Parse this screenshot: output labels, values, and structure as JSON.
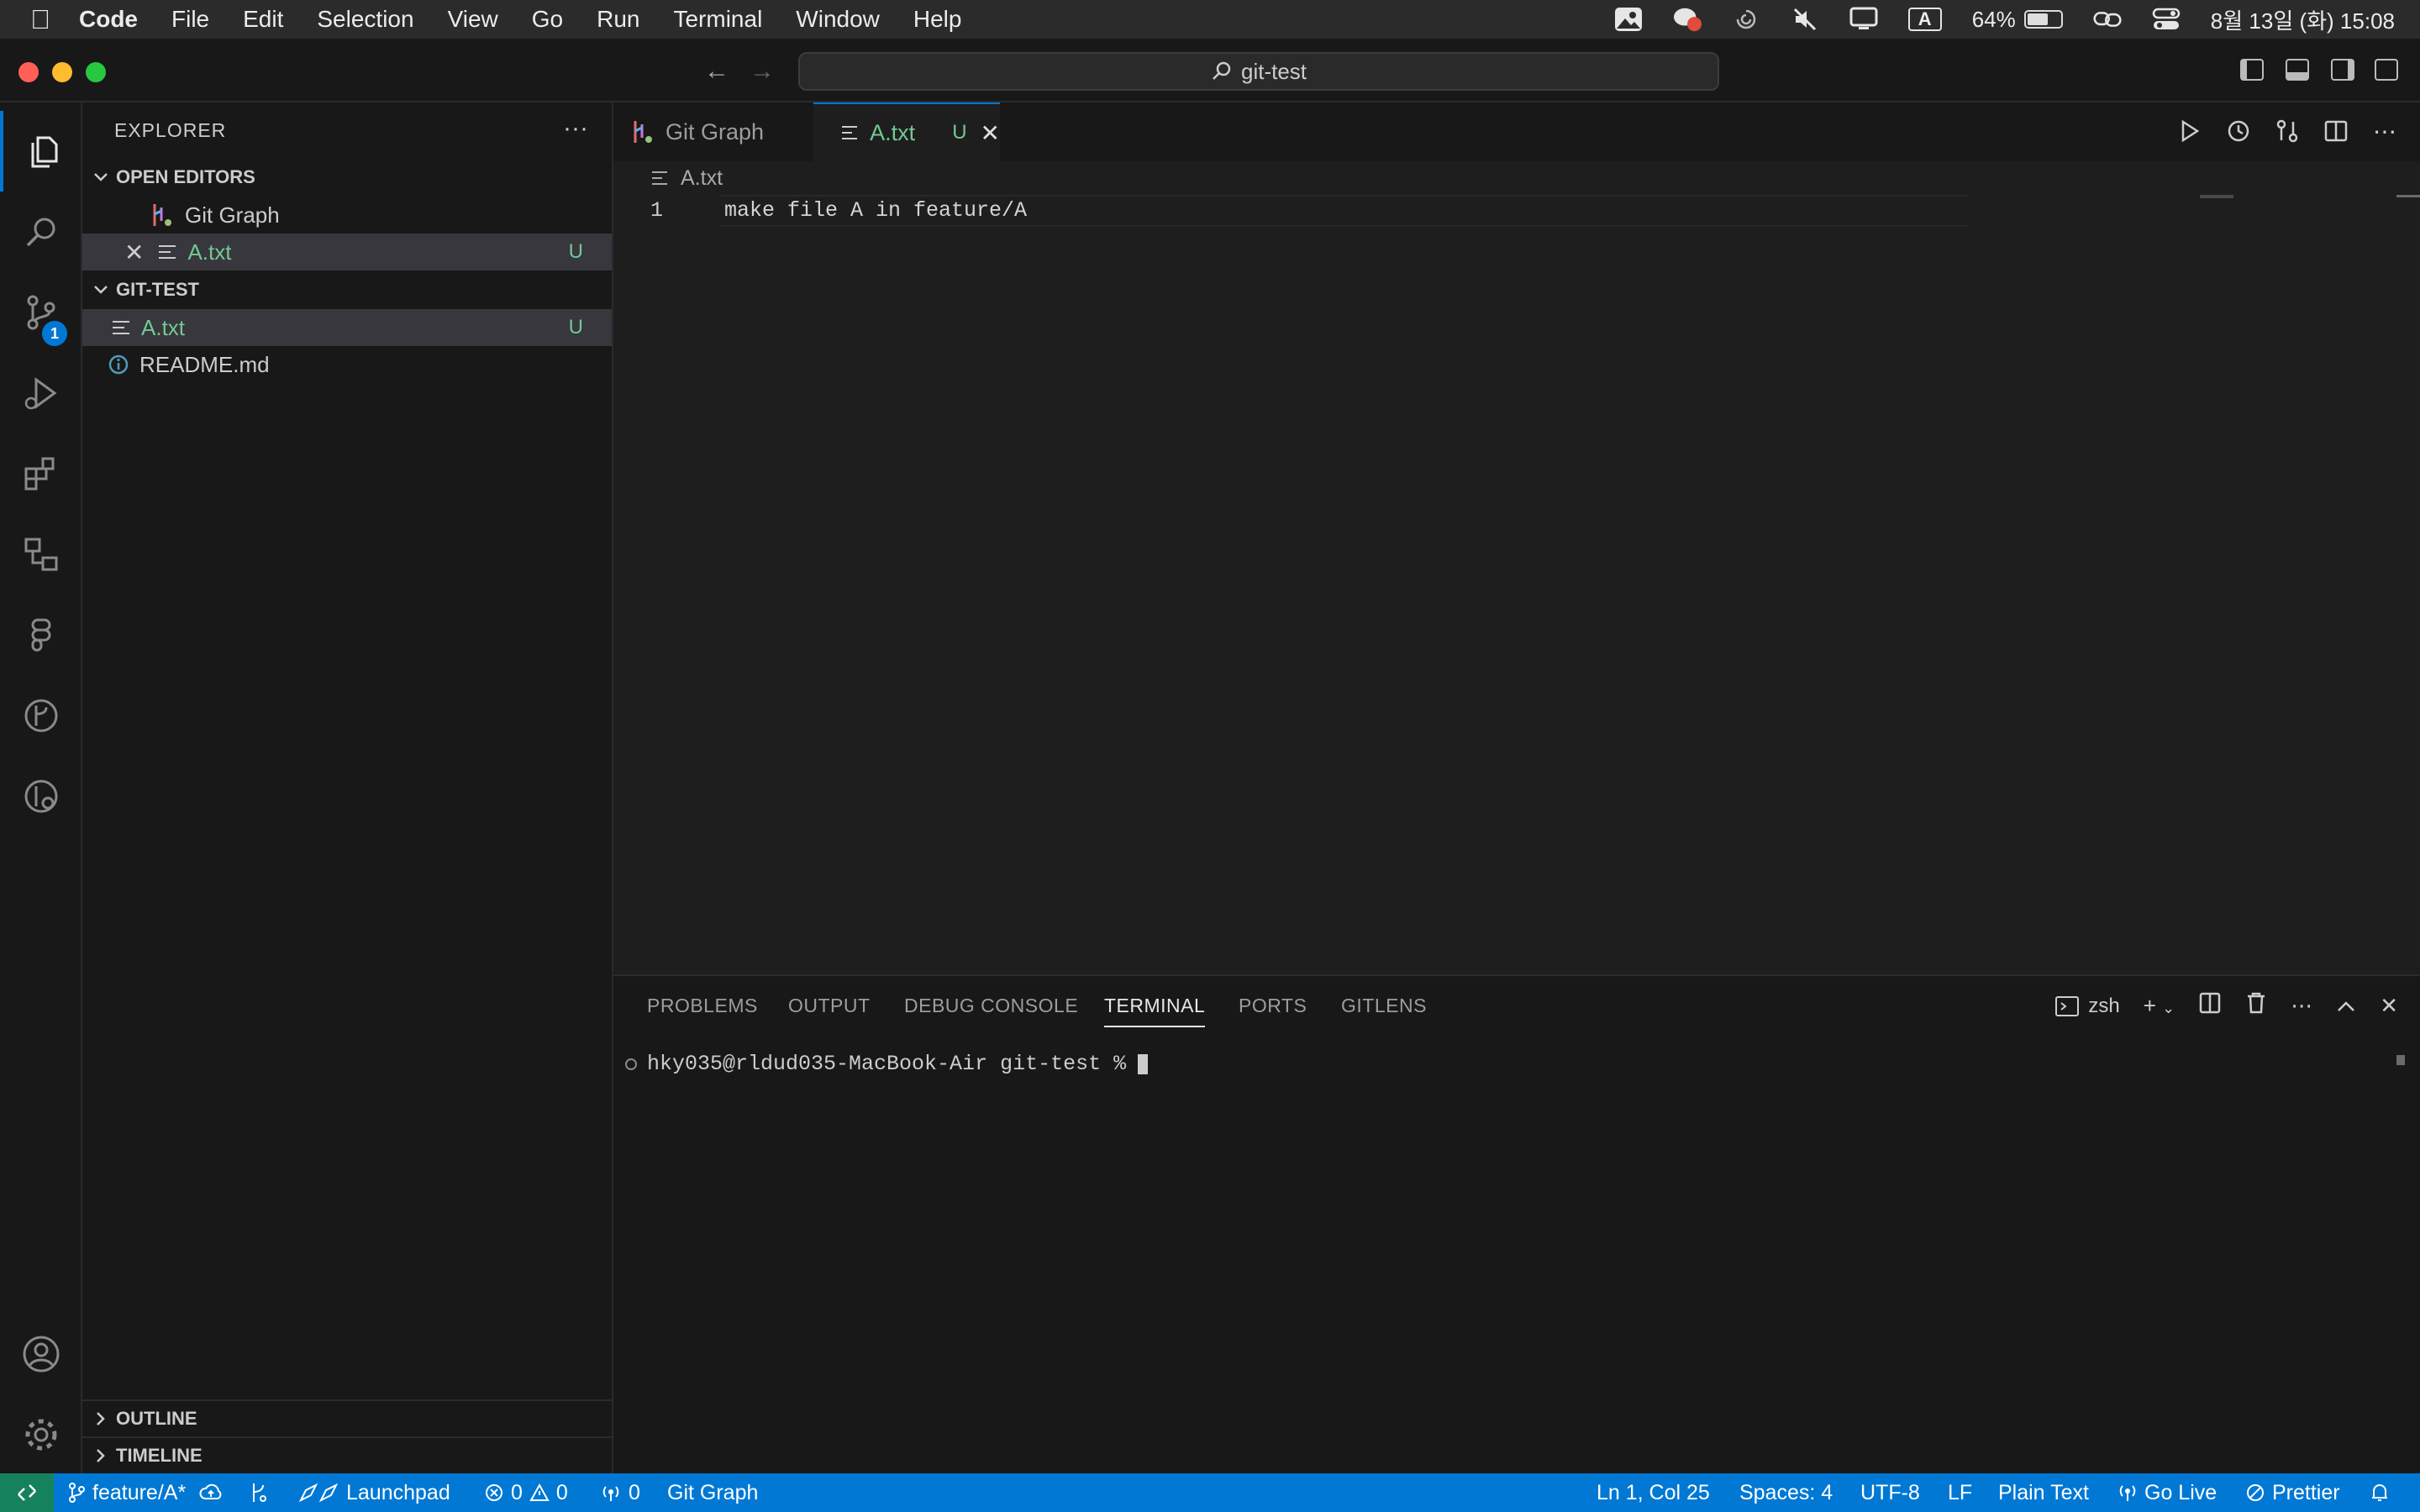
{
  "menubar": {
    "app_name": "Code",
    "items": [
      "File",
      "Edit",
      "Selection",
      "View",
      "Go",
      "Run",
      "Terminal",
      "Window",
      "Help"
    ],
    "battery_percent": "64%",
    "battery_level": 0.64,
    "input_mode": "A",
    "datetime": "8월 13일 (화) 15:08"
  },
  "titlebar": {
    "search_text": "git-test"
  },
  "activity": {
    "scm_badge": "1"
  },
  "sidebar": {
    "title": "EXPLORER",
    "more": "···",
    "open_editors_header": "OPEN EDITORS",
    "open_editors": [
      {
        "label": "Git Graph"
      },
      {
        "label": "A.txt",
        "status": "U"
      }
    ],
    "folder_header": "GIT-TEST",
    "files": [
      {
        "label": "A.txt",
        "status": "U"
      },
      {
        "label": "README.md"
      }
    ],
    "outline": "OUTLINE",
    "timeline": "TIMELINE"
  },
  "tabs": [
    {
      "label": "Git Graph"
    },
    {
      "label": "A.txt",
      "status": "U"
    }
  ],
  "editor": {
    "breadcrumb": "A.txt",
    "line_number": "1",
    "line_text": "make file A in feature/A"
  },
  "panel": {
    "tabs": [
      "PROBLEMS",
      "OUTPUT",
      "DEBUG CONSOLE",
      "TERMINAL",
      "PORTS",
      "GITLENS"
    ],
    "active_tab": "TERMINAL",
    "shell": "zsh",
    "prompt": "hky035@rldud035-MacBook-Air git-test %"
  },
  "statusbar": {
    "branch": "feature/A*",
    "launchpad": "Launchpad",
    "errors": "0",
    "warnings": "0",
    "ports": "0",
    "git_graph": "Git Graph",
    "position": "Ln 1, Col 25",
    "spaces": "Spaces: 4",
    "encoding": "UTF-8",
    "eol": "LF",
    "language": "Plain Text",
    "go_live": "Go Live",
    "prettier": "Prettier"
  },
  "colors": {
    "accent": "#0078d4",
    "untracked": "#73c991",
    "statusbar": "#0078d4"
  }
}
